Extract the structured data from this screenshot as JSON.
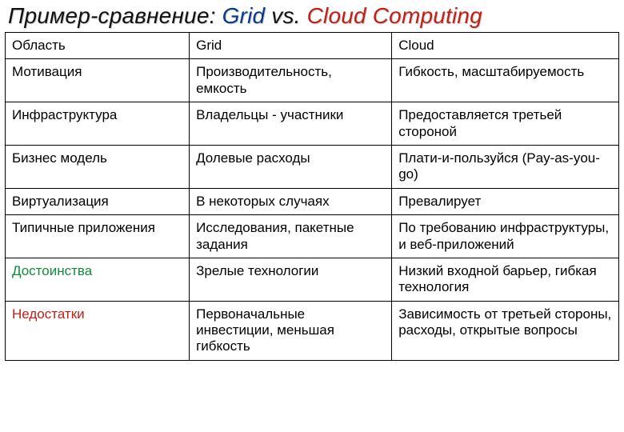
{
  "title": {
    "part1": "Пример-сравнение: ",
    "grid": "Grid",
    "vs": " vs. ",
    "cloud": "Cloud Computing"
  },
  "colors": {
    "title_shadow": "#cccccc",
    "grid_blue": "#0a3a8a",
    "cloud_red": "#c12015",
    "adv_green": "#118a3d"
  },
  "header": {
    "col1": "Область",
    "col2": "Grid",
    "col3": "Cloud"
  },
  "rows": [
    {
      "label": "Мотивация",
      "grid": "Производительность, емкость",
      "cloud": "Гибкость, масштабируемость"
    },
    {
      "label": "Инфраструктура",
      "grid": "Владельцы - участники",
      "cloud": "Предоставляется третьей стороной"
    },
    {
      "label": "Бизнес модель",
      "grid": "Долевые расходы",
      "cloud": "Плати-и-пользуйся (Pay-as-you-go)"
    },
    {
      "label": "Виртуализация",
      "grid": "В некоторых случаях",
      "cloud": "Превалирует"
    },
    {
      "label": "Типичные приложения",
      "grid": "Исследования, пакетные задания",
      "cloud": "По требованию инфраструктуры, и веб-приложений"
    },
    {
      "label": "Достоинства",
      "label_color": "green",
      "grid": "Зрелые технологии",
      "cloud": "Низкий входной барьер, гибкая технология"
    },
    {
      "label": "Недостатки",
      "label_color": "red",
      "grid": "Первоначальные инвестиции, меньшая гибкость",
      "cloud": "Зависимость от третьей стороны, расходы, открытые вопросы"
    }
  ]
}
